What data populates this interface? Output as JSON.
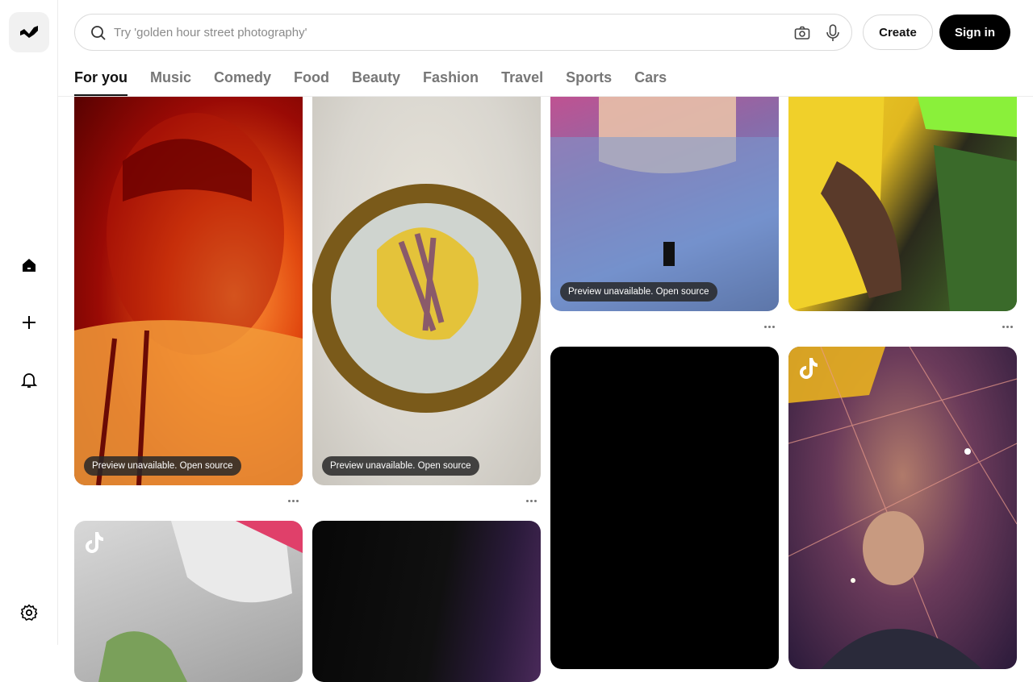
{
  "search": {
    "placeholder": "Try 'golden hour street photography'"
  },
  "header": {
    "create_label": "Create",
    "signin_label": "Sign in"
  },
  "tabs": [
    {
      "label": "For you",
      "active": true
    },
    {
      "label": "Music"
    },
    {
      "label": "Comedy"
    },
    {
      "label": "Food"
    },
    {
      "label": "Beauty"
    },
    {
      "label": "Fashion"
    },
    {
      "label": "Travel"
    },
    {
      "label": "Sports"
    },
    {
      "label": "Cars"
    }
  ],
  "sidebar": {
    "icons": [
      "logo-icon",
      "home-icon",
      "plus-icon",
      "bell-icon",
      "gear-icon"
    ]
  },
  "cards": [
    {
      "badge": "Preview unavailable. Open source"
    },
    {
      "badge": "Preview unavailable. Open source"
    },
    {
      "badge": "Preview unavailable. Open source"
    },
    {
      "badge": ""
    },
    {
      "badge": ""
    },
    {
      "badge": ""
    },
    {
      "badge": ""
    },
    {
      "badge": ""
    }
  ]
}
